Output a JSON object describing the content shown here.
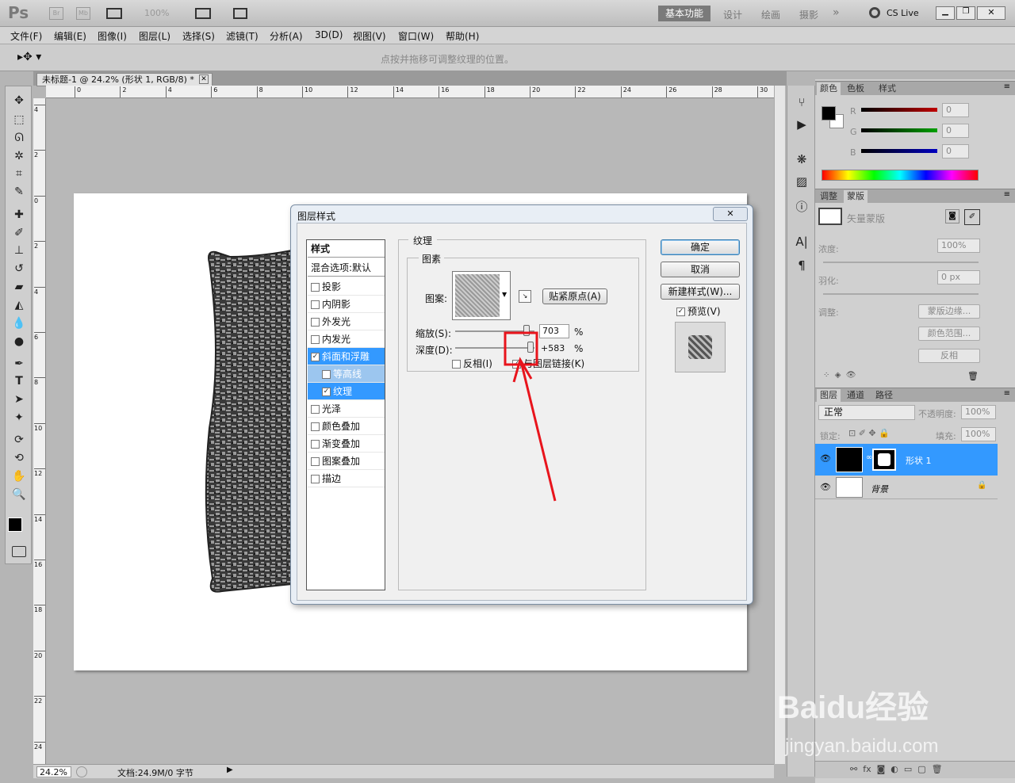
{
  "app": {
    "logo": "Ps",
    "bridge_label": "Br",
    "minibridge_label": "Mb",
    "zoom": "100%",
    "workspaces": [
      "基本功能",
      "设计",
      "绘画",
      "摄影"
    ],
    "more": "»",
    "cslive": "CS Live"
  },
  "menu": [
    "文件(F)",
    "编辑(E)",
    "图像(I)",
    "图层(L)",
    "选择(S)",
    "滤镜(T)",
    "分析(A)",
    "3D(D)",
    "视图(V)",
    "窗口(W)",
    "帮助(H)"
  ],
  "options_hint": "点按并拖移可调整纹理的位置。",
  "doc_tab": "未标题-1 @ 24.2% (形状 1, RGB/8) *",
  "ruler_h": [
    "0",
    "2",
    "4",
    "6",
    "8",
    "10",
    "12",
    "14",
    "16",
    "18",
    "20",
    "22",
    "24",
    "26",
    "28",
    "30"
  ],
  "ruler_v": [
    "4",
    "2",
    "0",
    "2",
    "4",
    "6",
    "8",
    "10",
    "12",
    "14",
    "16",
    "18",
    "20",
    "22",
    "24"
  ],
  "status": {
    "zoom": "24.2%",
    "doc": "文档:24.9M/0 字节"
  },
  "color_panel": {
    "tabs": [
      "颜色",
      "色板",
      "样式"
    ],
    "channels": [
      {
        "label": "R",
        "value": "0",
        "color": "#c00000"
      },
      {
        "label": "G",
        "value": "0",
        "color": "#00a000"
      },
      {
        "label": "B",
        "value": "0",
        "color": "#0000c0"
      }
    ]
  },
  "adjust_panel": {
    "tabs": [
      "调整",
      "蒙版"
    ],
    "vector_mask": "矢量蒙版",
    "density_label": "浓度:",
    "density_value": "100%",
    "feather_label": "羽化:",
    "feather_value": "0 px",
    "refine_label": "调整:",
    "buttons": [
      "蒙版边缘...",
      "颜色范围...",
      "反相"
    ]
  },
  "layers_panel": {
    "tabs": [
      "图层",
      "通道",
      "路径"
    ],
    "blend_mode": "正常",
    "opacity_label": "不透明度:",
    "opacity_value": "100%",
    "lock_label": "锁定:",
    "fill_label": "填充:",
    "fill_value": "100%",
    "layers": [
      {
        "name": "形状 1",
        "selected": true
      },
      {
        "name": "背景",
        "selected": false
      }
    ]
  },
  "dialog": {
    "title": "图层样式",
    "styles_header": "样式",
    "blend_options": "混合选项:默认",
    "style_items": [
      {
        "label": "投影",
        "checked": false,
        "kind": "normal"
      },
      {
        "label": "内阴影",
        "checked": false,
        "kind": "normal"
      },
      {
        "label": "外发光",
        "checked": false,
        "kind": "normal"
      },
      {
        "label": "内发光",
        "checked": false,
        "kind": "normal"
      },
      {
        "label": "斜面和浮雕",
        "checked": true,
        "kind": "sel"
      },
      {
        "label": "等高线",
        "checked": false,
        "kind": "subsel"
      },
      {
        "label": "纹理",
        "checked": true,
        "kind": "subactive"
      },
      {
        "label": "光泽",
        "checked": false,
        "kind": "normal"
      },
      {
        "label": "颜色叠加",
        "checked": false,
        "kind": "normal"
      },
      {
        "label": "渐变叠加",
        "checked": false,
        "kind": "normal"
      },
      {
        "label": "图案叠加",
        "checked": false,
        "kind": "normal"
      },
      {
        "label": "描边",
        "checked": false,
        "kind": "normal"
      }
    ],
    "texture_group": "纹理",
    "elements_group": "图素",
    "pattern_label": "图案:",
    "snap_button": "贴紧原点(A)",
    "scale_label": "缩放(S):",
    "scale_value": "703",
    "scale_pct": 0.9,
    "depth_label": "深度(D):",
    "depth_value": "+583",
    "depth_pct": 0.95,
    "percent": "%",
    "invert_label": "反相(I)",
    "link_label": "与图层链接(K)",
    "link_checked": true,
    "ok": "确定",
    "cancel": "取消",
    "new_style": "新建样式(W)...",
    "preview_label": "预览(V)",
    "preview_checked": true
  },
  "watermark": {
    "brand": "Baidu经验",
    "url": "jingyan.baidu.com"
  },
  "colors": {
    "accent": "#3399ff",
    "annotation": "#e8141c"
  }
}
